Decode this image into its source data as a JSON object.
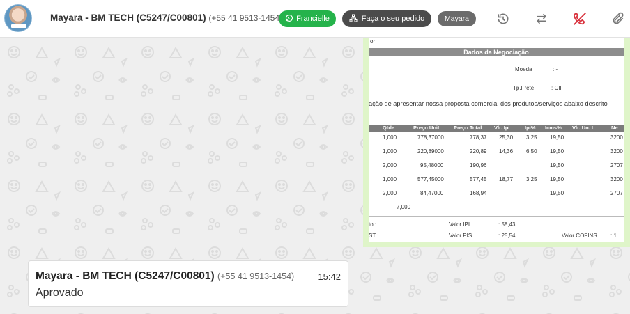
{
  "header": {
    "contact_name": "Mayara - BM TECH (C5247/C00801)",
    "contact_phone": "(+55 41 9513-1454)",
    "agent_button": "Francielle",
    "order_button": "Faça o seu pedido",
    "user_badge": "Mayara",
    "icons": [
      "history-icon",
      "transfer-icon",
      "end-call-icon",
      "attachment-icon"
    ],
    "colors": {
      "agent": "#25b34b",
      "order": "#4b4b4b",
      "badge": "#6b6b6b",
      "end_call": "#d9343f"
    }
  },
  "image_message": {
    "doc": {
      "top_fragment": "or",
      "section_title": "Dados da Negociação",
      "moeda_label": "Moeda",
      "moeda_value": ": -",
      "frete_label": "Tp.Frete",
      "frete_value": ": CIF",
      "intro": "ação de apresentar nossa proposta comercial dos produtos/serviços abaixo descrito",
      "columns": [
        "Qtde",
        "Preço Unit",
        "Preço Total",
        "Vlr. Ipi",
        "Ipi%",
        "Icms%",
        "Vlr. Un. t.",
        "Ne"
      ],
      "rows": [
        [
          "1,000",
          "778,37000",
          "778,37",
          "25,30",
          "3,25",
          "19,50",
          "",
          "3200"
        ],
        [
          "1,000",
          "220,89000",
          "220,89",
          "14,36",
          "6,50",
          "19,50",
          "",
          "3200"
        ],
        [
          "2,000",
          "95,48000",
          "190,96",
          "",
          "",
          "19,50",
          "",
          "2707"
        ],
        [
          "1,000",
          "577,45000",
          "577,45",
          "18,77",
          "3,25",
          "19,50",
          "",
          "3200"
        ],
        [
          "2,000",
          "84,47000",
          "168,94",
          "",
          "",
          "19,50",
          "",
          "2707"
        ]
      ],
      "total_qty": "7,000",
      "footer_left_1": "to   :",
      "footer_left_2": "ST   :",
      "ipi_label": "Valor IPI",
      "ipi_value": ":   58,43",
      "pis_label": "Valor PIS",
      "pis_value": ":   25,54",
      "cofins_label": "Valor COFINS",
      "cofins_value": ":   1"
    }
  },
  "text_message": {
    "sender": "Mayara - BM TECH (C5247/C00801)",
    "sender_phone": "(+55 41 9513-1454)",
    "time": "15:42",
    "text": "Aprovado"
  }
}
